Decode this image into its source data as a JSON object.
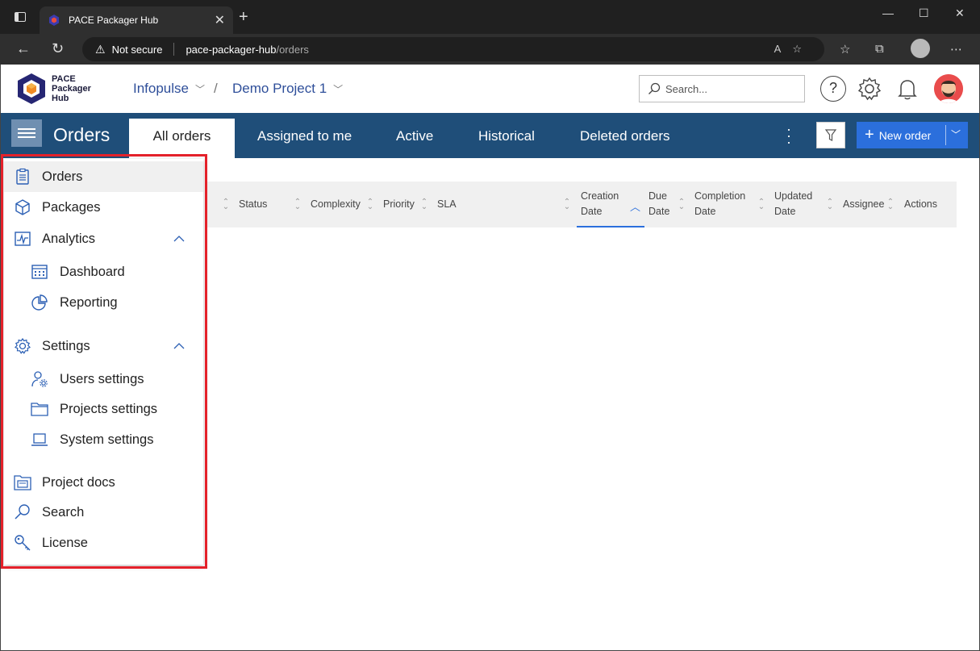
{
  "browser": {
    "tab_title": "PACE Packager Hub",
    "security_label": "Not secure",
    "url_host": "pace-packager-hub",
    "url_path": "/orders"
  },
  "app": {
    "logo_lines": [
      "PACE",
      "Packager",
      "Hub"
    ],
    "breadcrumb": [
      {
        "label": "Infopulse"
      },
      {
        "label": "Demo Project 1"
      }
    ],
    "breadcrumb_separator": "/",
    "search_placeholder": "Search...",
    "help_label": "?"
  },
  "navbar": {
    "title": "Orders",
    "tabs": [
      {
        "label": "All orders",
        "active": true
      },
      {
        "label": "Assigned to me"
      },
      {
        "label": "Active"
      },
      {
        "label": "Historical"
      },
      {
        "label": "Deleted orders"
      }
    ],
    "new_order_label": "New order",
    "colors": {
      "bar": "#1f4e79",
      "primary_button": "#2b6fdc"
    }
  },
  "table": {
    "columns": [
      {
        "label": "Status"
      },
      {
        "label": "Complexity"
      },
      {
        "label": "Priority"
      },
      {
        "label": "SLA"
      },
      {
        "label": "Creation Date",
        "lines": [
          "Creation",
          "Date"
        ],
        "sorted": "asc"
      },
      {
        "label": "Due Date",
        "lines": [
          "Due",
          "Date"
        ]
      },
      {
        "label": "Completion Date",
        "lines": [
          "Completion",
          "Date"
        ]
      },
      {
        "label": "Updated Date",
        "lines": [
          "Updated",
          "Date"
        ]
      },
      {
        "label": "Assignee"
      },
      {
        "label": "Actions"
      }
    ]
  },
  "side_menu": {
    "items": [
      {
        "label": "Orders",
        "icon": "clipboard-icon",
        "selected": true
      },
      {
        "label": "Packages",
        "icon": "cube-icon"
      },
      {
        "label": "Analytics",
        "icon": "chart-icon",
        "expanded": true
      },
      {
        "label": "Dashboard",
        "icon": "calendar-icon",
        "sub": true
      },
      {
        "label": "Reporting",
        "icon": "pie-chart-icon",
        "sub": true
      },
      {
        "label": "Settings",
        "icon": "gear-icon",
        "expanded": true
      },
      {
        "label": "Users settings",
        "icon": "user-settings-icon",
        "sub": true
      },
      {
        "label": "Projects settings",
        "icon": "folder-icon",
        "sub": true
      },
      {
        "label": "System settings",
        "icon": "laptop-icon",
        "sub": true
      },
      {
        "label": "Project docs",
        "icon": "docs-folder-icon"
      },
      {
        "label": "Search",
        "icon": "search-icon"
      },
      {
        "label": "License",
        "icon": "key-icon"
      }
    ],
    "highlight_color": "#e4212a"
  }
}
